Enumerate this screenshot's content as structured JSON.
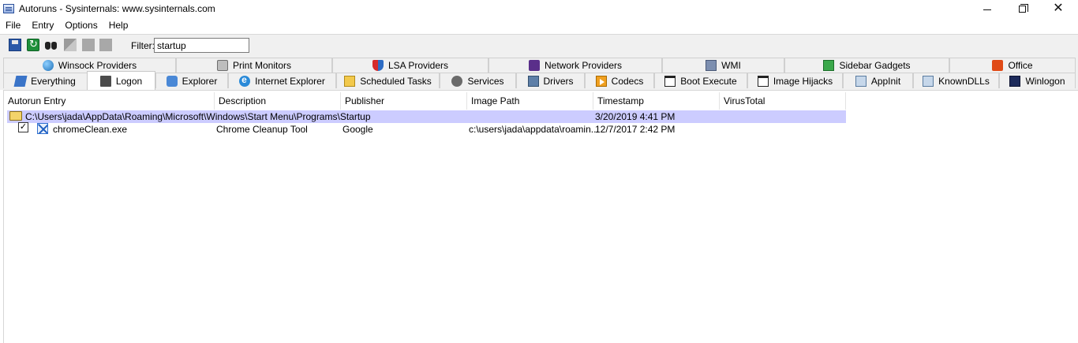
{
  "window": {
    "title": "Autoruns - Sysinternals: www.sysinternals.com",
    "min_symbol": "",
    "max_symbol": "",
    "close_symbol": "✕"
  },
  "menu": [
    "File",
    "Entry",
    "Options",
    "Help"
  ],
  "toolbar": {
    "filter_label": "Filter:",
    "filter_value": "startup",
    "icons": [
      "save-icon",
      "refresh-icon",
      "find-icon",
      "grey-icon",
      "grey-icon",
      "grey-icon"
    ]
  },
  "tabs": {
    "row1": [
      {
        "label": "Winsock Providers",
        "icon": "globe-icon"
      },
      {
        "label": "Print Monitors",
        "icon": "printer-icon"
      },
      {
        "label": "LSA Providers",
        "icon": "shield-icon"
      },
      {
        "label": "Network Providers",
        "icon": "network-icon"
      },
      {
        "label": "WMI",
        "icon": "wmi-icon"
      },
      {
        "label": "Sidebar Gadgets",
        "icon": "gadget-icon"
      },
      {
        "label": "Office",
        "icon": "office-icon"
      }
    ],
    "row2": [
      {
        "label": "Everything",
        "icon": "everything-icon"
      },
      {
        "label": "Logon",
        "icon": "logon-icon"
      },
      {
        "label": "Explorer",
        "icon": "explorer-icon"
      },
      {
        "label": "Internet Explorer",
        "icon": "ie-icon"
      },
      {
        "label": "Scheduled Tasks",
        "icon": "tasks-icon"
      },
      {
        "label": "Services",
        "icon": "services-icon"
      },
      {
        "label": "Drivers",
        "icon": "drivers-icon"
      },
      {
        "label": "Codecs",
        "icon": "codecs-icon"
      },
      {
        "label": "Boot Execute",
        "icon": "boot-icon"
      },
      {
        "label": "Image Hijacks",
        "icon": "hijack-icon"
      },
      {
        "label": "AppInit",
        "icon": "appinit-icon"
      },
      {
        "label": "KnownDLLs",
        "icon": "knowndll-icon"
      },
      {
        "label": "Winlogon",
        "icon": "winlogon-icon"
      }
    ],
    "active": "Logon"
  },
  "columns": [
    "Autorun Entry",
    "Description",
    "Publisher",
    "Image Path",
    "Timestamp",
    "VirusTotal"
  ],
  "group": {
    "path": "C:\\Users\\jada\\AppData\\Roaming\\Microsoft\\Windows\\Start Menu\\Programs\\Startup",
    "timestamp": "3/20/2019 4:41 PM"
  },
  "entries": [
    {
      "checked": "✓",
      "name": "chromeClean.exe",
      "description": "Chrome Cleanup Tool",
      "publisher": "Google",
      "image_path": "c:\\users\\jada\\appdata\\roamin...",
      "timestamp": "12/7/2017 2:42 PM",
      "virustotal": ""
    }
  ]
}
